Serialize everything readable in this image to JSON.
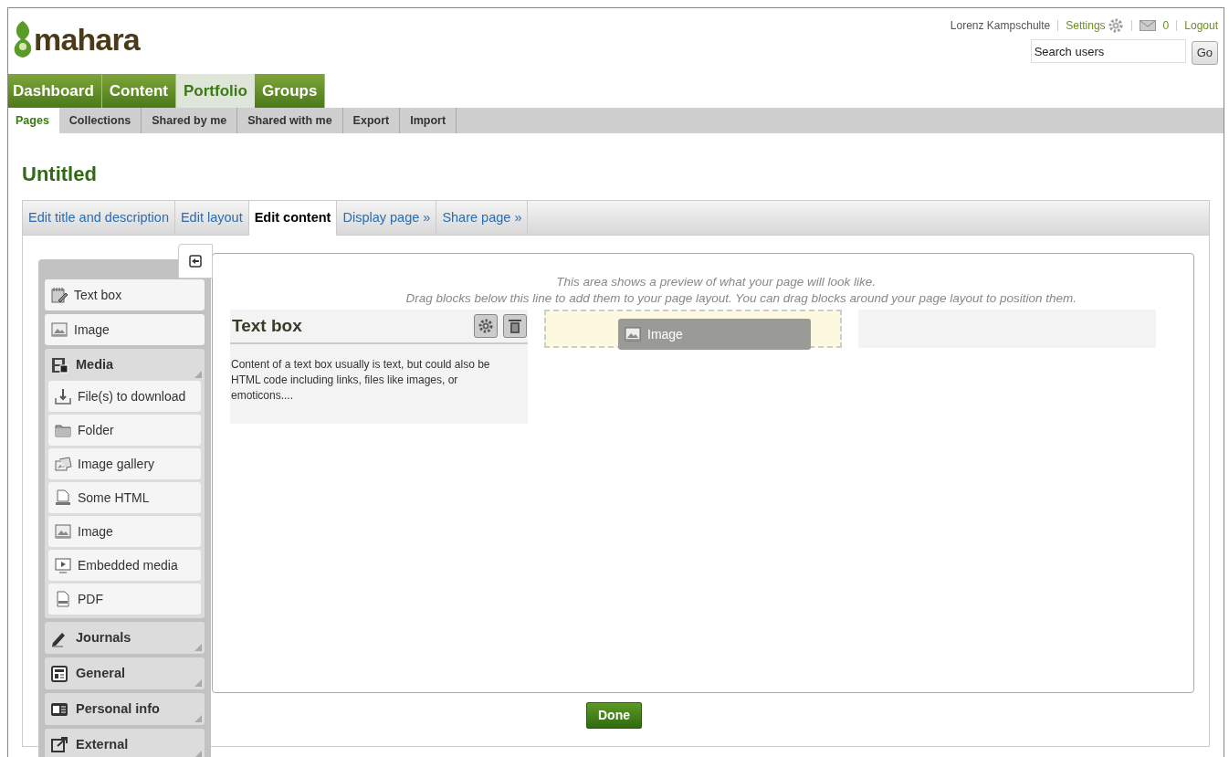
{
  "site": {
    "logo": "mahara"
  },
  "user_menu": {
    "user": "Lorenz Kampschulte",
    "settings": "Settings",
    "messages": "0",
    "logout": "Logout",
    "search": {
      "placeholder": "Search users"
    },
    "go": "Go"
  },
  "main_nav": [
    {
      "label": "Dashboard",
      "selected": false
    },
    {
      "label": "Content",
      "selected": false
    },
    {
      "label": "Portfolio",
      "selected": true
    },
    {
      "label": "Groups",
      "selected": false
    }
  ],
  "sub_nav": [
    {
      "label": "Pages",
      "selected": true
    },
    {
      "label": "Collections",
      "selected": false
    },
    {
      "label": "Shared by me",
      "selected": false
    },
    {
      "label": "Shared with me",
      "selected": false
    },
    {
      "label": "Export",
      "selected": false
    },
    {
      "label": "Import",
      "selected": false
    }
  ],
  "page_title": "Untitled",
  "edit_tabs": [
    {
      "label": "Edit title and description",
      "selected": false
    },
    {
      "label": "Edit layout",
      "selected": false
    },
    {
      "label": "Edit content",
      "selected": true
    },
    {
      "label": "Display page »",
      "selected": false
    },
    {
      "label": "Share page »",
      "selected": false
    }
  ],
  "block_palette": [
    {
      "kind": "item",
      "label": "Text box"
    },
    {
      "kind": "item",
      "label": "Image"
    },
    {
      "kind": "category",
      "label": "Media",
      "expanded": true,
      "children": [
        {
          "kind": "item",
          "label": "File(s) to download"
        },
        {
          "kind": "item",
          "label": "Folder"
        },
        {
          "kind": "item",
          "label": "Image gallery"
        },
        {
          "kind": "item",
          "label": "Some HTML"
        },
        {
          "kind": "item",
          "label": "Image"
        },
        {
          "kind": "item",
          "label": "Embedded media"
        },
        {
          "kind": "item",
          "label": "PDF"
        }
      ]
    },
    {
      "kind": "category",
      "label": "Journals",
      "expanded": false
    },
    {
      "kind": "category",
      "label": "General",
      "expanded": false
    },
    {
      "kind": "category",
      "label": "Personal info",
      "expanded": false
    },
    {
      "kind": "category",
      "label": "External",
      "expanded": false
    }
  ],
  "preview": {
    "hint": [
      "This area shows a preview of what your page will look like.",
      "Drag blocks below this line to add them to your page layout. You can drag blocks around your page layout to position them."
    ],
    "columns": [
      {
        "kind": "block",
        "title": "Text box",
        "body": "Content of a text box usually is text, but could also be HTML code including links, files like images, or emoticons...."
      },
      {
        "kind": "dropzone",
        "dragged": "Image"
      },
      {
        "kind": "empty"
      }
    ]
  },
  "done_button": "Done"
}
